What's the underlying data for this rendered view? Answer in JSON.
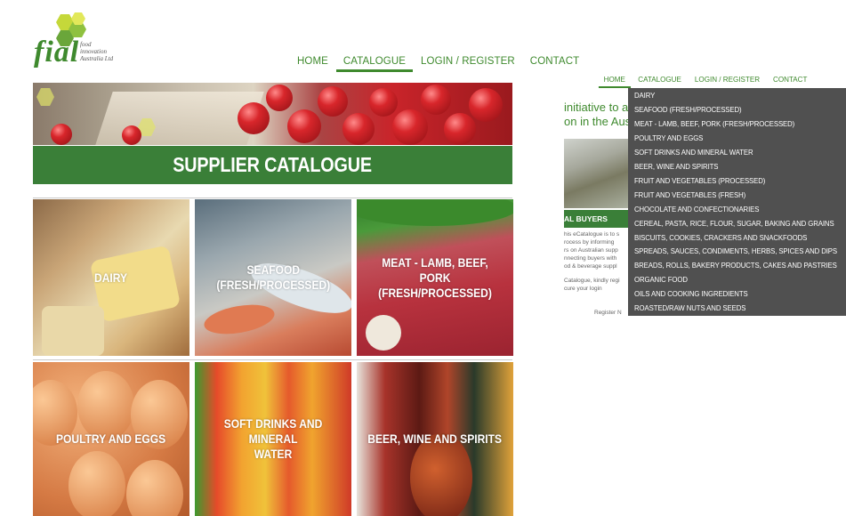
{
  "logo": {
    "word": "fial",
    "sub": "food\ninnovation\nAustralia Ltd"
  },
  "nav": [
    {
      "label": "HOME",
      "active": false
    },
    {
      "label": "CATALOGUE",
      "active": true
    },
    {
      "label": "LOGIN / REGISTER",
      "active": false
    },
    {
      "label": "CONTACT",
      "active": false
    }
  ],
  "nav_small": [
    {
      "label": "HOME",
      "active": true
    },
    {
      "label": "CATALOGUE",
      "active": false
    },
    {
      "label": "LOGIN / REGISTER",
      "active": false
    },
    {
      "label": "CONTACT",
      "active": false
    }
  ],
  "page_title": "SUPPLIER CATALOGUE",
  "tiles": [
    {
      "id": "dairy",
      "label": "DAIRY"
    },
    {
      "id": "seafood",
      "label": "SEAFOOD\n(FRESH/PROCESSED)"
    },
    {
      "id": "meat",
      "label": "MEAT - LAMB, BEEF, PORK\n(FRESH/PROCESSED)"
    },
    {
      "id": "poultry",
      "label": "POULTRY AND EGGS"
    },
    {
      "id": "drinks",
      "label": "SOFT DRINKS AND MINERAL\nWATER"
    },
    {
      "id": "beer",
      "label": "BEER, WINE AND SPIRITS"
    }
  ],
  "background_page": {
    "heading_line1": "initiative to a",
    "heading_line2": "on in the Aust",
    "banner": "AL BUYERS",
    "para1": "his eCatalogue is to s\nrocess by informing\nrs on Australian supp\nnnecting buyers with\nod & beverage suppl",
    "para2": "Catalogue, kindly regi\ncure your login",
    "footer": "Register N"
  },
  "dropdown": [
    "DAIRY",
    "SEAFOOD (FRESH/PROCESSED)",
    "MEAT - LAMB, BEEF, PORK (FRESH/PROCESSED)",
    "POULTRY AND EGGS",
    "SOFT DRINKS AND MINERAL WATER",
    "BEER, WINE AND SPIRITS",
    "FRUIT AND VEGETABLES (PROCESSED)",
    "FRUIT AND VEGETABLES (FRESH)",
    "CHOCOLATE AND CONFECTIONARIES",
    "CEREAL, PASTA, RICE, FLOUR, SUGAR, BAKING AND GRAINS",
    "BISCUITS, COOKIES, CRACKERS AND SNACKFOODS",
    "SPREADS, SAUCES, CONDIMENTS, HERBS, SPICES AND DIPS",
    "BREADS, ROLLS, BAKERY PRODUCTS, CAKES AND PASTRIES",
    "ORGANIC FOOD",
    "OILS AND COOKING INGREDIENTS",
    "ROASTED/RAW NUTS AND SEEDS"
  ],
  "colors": {
    "brand_green": "#3a7f38",
    "nav_green": "#3f8a2e",
    "dropdown_bg": "#505050"
  }
}
